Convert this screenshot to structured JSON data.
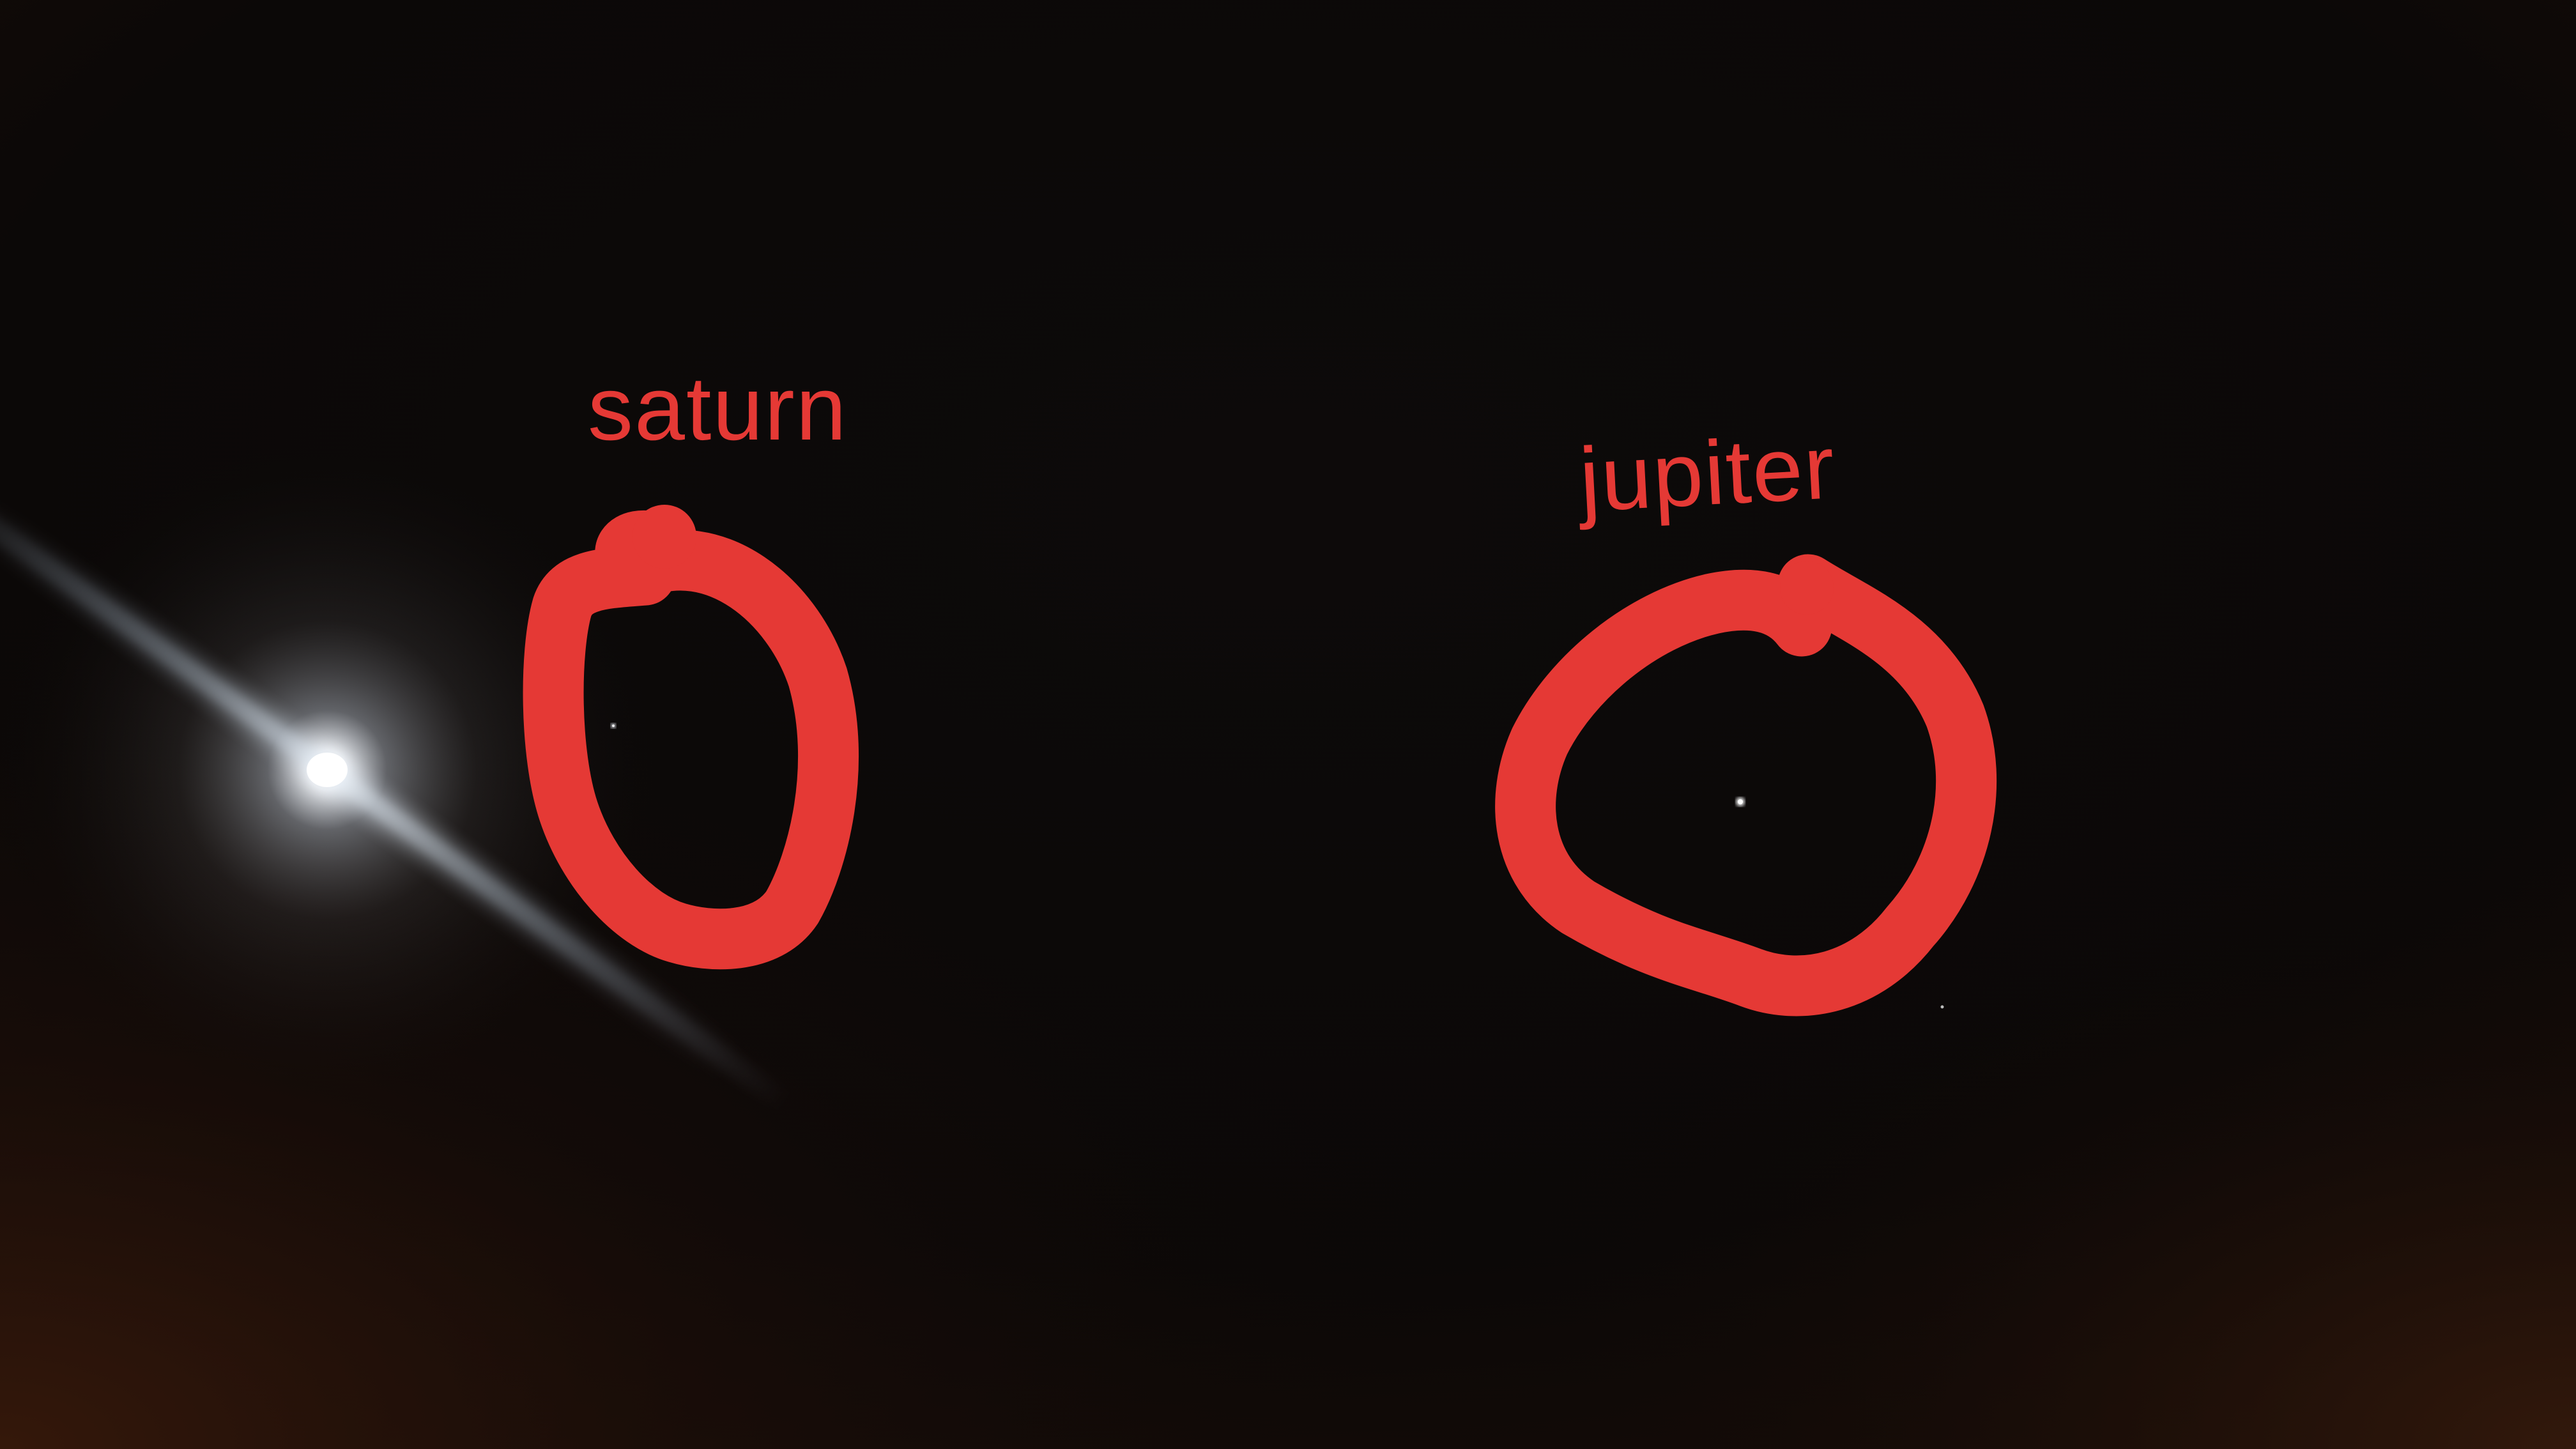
{
  "annotations": {
    "saturn": {
      "label": "saturn"
    },
    "jupiter": {
      "label": "jupiter"
    }
  },
  "colors": {
    "sky": "#0b0807",
    "sky_warm": "#2a140b",
    "annotation": "#e53935",
    "moon": "#ffffff",
    "moon_glow": "#cfd6e0",
    "planet": "#e8e8e8"
  },
  "scene": {
    "objects": [
      "moon",
      "saturn",
      "jupiter",
      "faint-star"
    ]
  }
}
